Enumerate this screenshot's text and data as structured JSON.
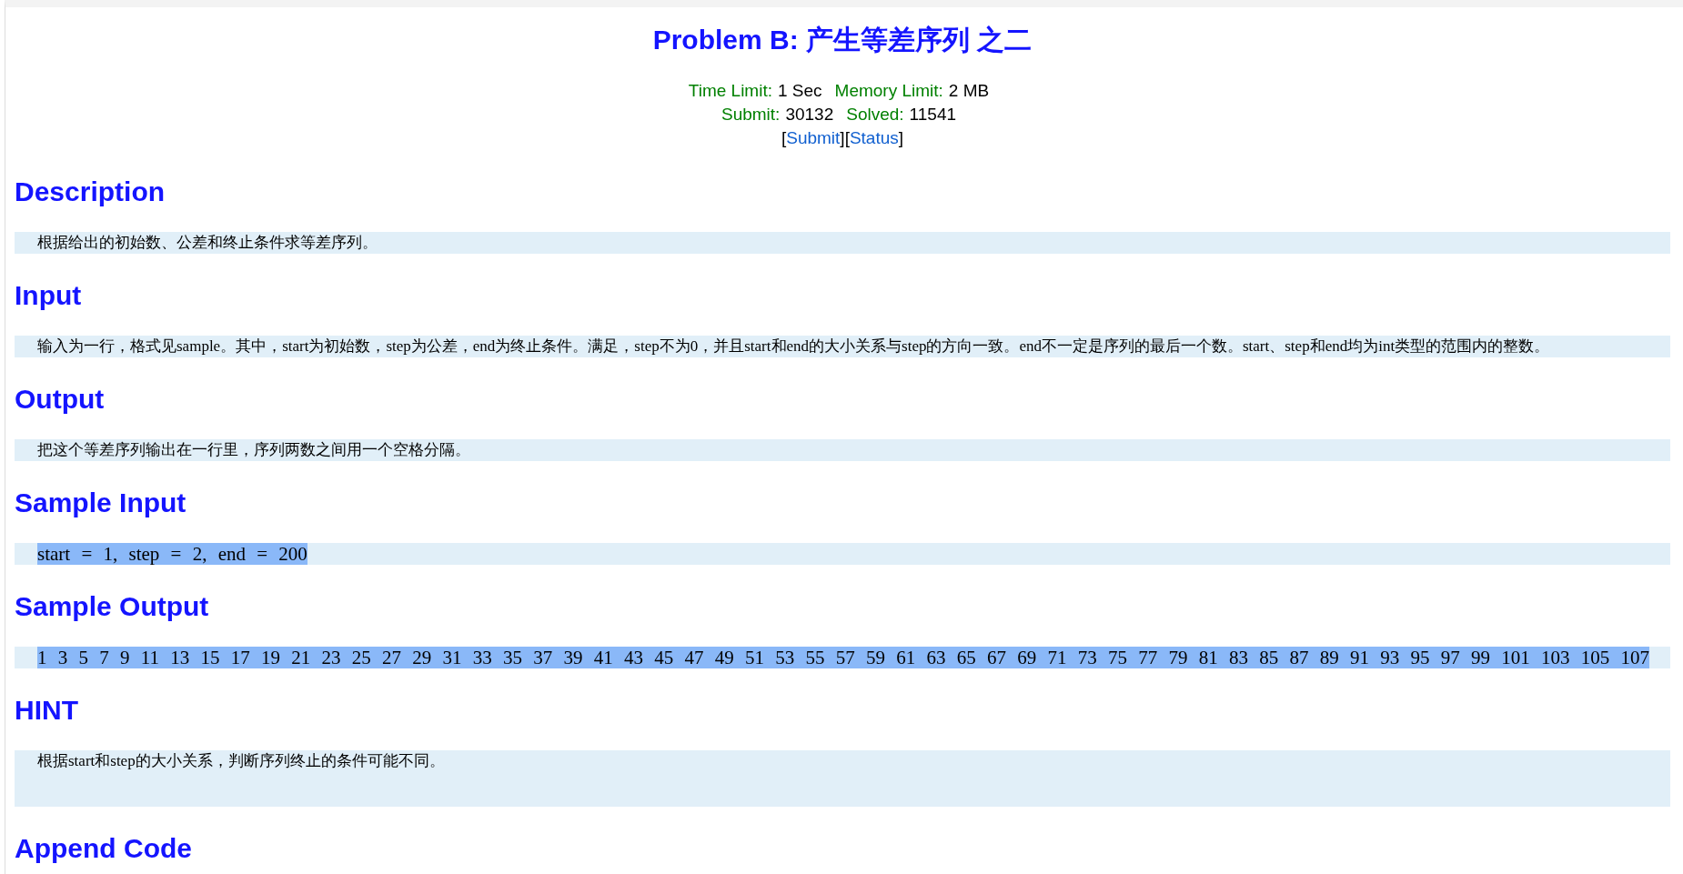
{
  "title": "Problem B: 产生等差序列 之二",
  "limits": [
    {
      "label": "Time Limit:",
      "value": "1 Sec"
    },
    {
      "label": "Memory Limit:",
      "value": "2 MB"
    }
  ],
  "stats": [
    {
      "label": "Submit:",
      "value": "30132"
    },
    {
      "label": "Solved:",
      "value": "11541"
    }
  ],
  "links": [
    {
      "open": "[",
      "label": "Submit",
      "close": "]"
    },
    {
      "open": "[",
      "label": "Status",
      "close": "]"
    }
  ],
  "sections": [
    {
      "heading": "Description",
      "kind": "text",
      "body": "根据给出的初始数、公差和终止条件求等差序列。"
    },
    {
      "heading": "Input",
      "kind": "text",
      "body": "输入为一行，格式见sample。其中，start为初始数，step为公差，end为终止条件。满足，step不为0，并且start和end的大小关系与step的方向一致。end不一定是序列的最后一个数。start、step和end均为int类型的范围内的整数。"
    },
    {
      "heading": "Output",
      "kind": "text",
      "body": "把这个等差序列输出在一行里，序列两数之间用一个空格分隔。"
    },
    {
      "heading": "Sample Input",
      "kind": "code",
      "body": "start = 1, step = 2, end = 200",
      "highlighted": true
    },
    {
      "heading": "Sample Output",
      "kind": "code",
      "body": "1 3 5 7 9 11 13 15 17 19 21 23 25 27 29 31 33 35 37 39 41 43 45 47 49 51 53 55 57 59 61 63 65 67 69 71 73 75 77 79 81 83 85 87 89 91 93 95 97 99 101 103 105 107",
      "highlighted": true
    },
    {
      "heading": "HINT",
      "kind": "tall",
      "body": "根据start和step的大小关系，判断序列终止的条件可能不同。"
    },
    {
      "heading": "Append Code",
      "kind": "none"
    }
  ]
}
